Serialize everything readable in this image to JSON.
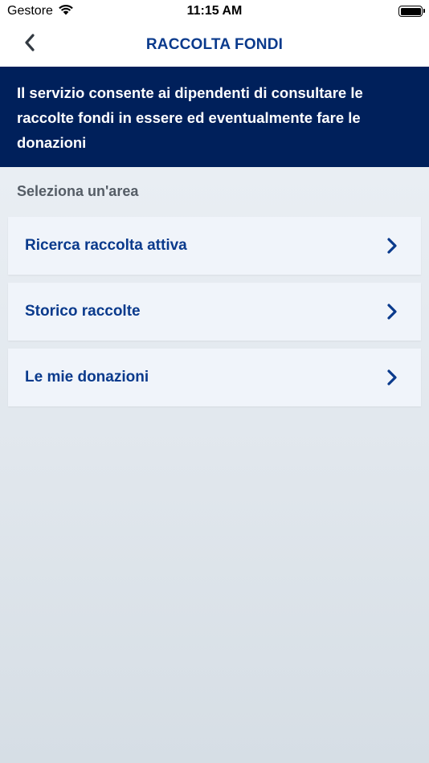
{
  "status_bar": {
    "carrier": "Gestore",
    "time": "11:15 AM",
    "wifi_icon": "wifi-icon",
    "battery_icon": "battery-icon"
  },
  "nav": {
    "title": "RACCOLTA FONDI",
    "back_icon": "chevron-left-icon"
  },
  "banner": {
    "text": "Il servizio consente ai dipendenti di consultare le raccolte fondi in essere ed eventualmente fare le donazioni"
  },
  "section": {
    "label": "Seleziona un'area"
  },
  "menu": {
    "items": [
      {
        "label": "Ricerca raccolta attiva",
        "icon": "chevron-right-icon"
      },
      {
        "label": "Storico raccolte",
        "icon": "chevron-right-icon"
      },
      {
        "label": "Le mie donazioni",
        "icon": "chevron-right-icon"
      }
    ]
  },
  "colors": {
    "brand_dark": "#00205b",
    "brand_blue": "#0a3a8c",
    "card_bg": "#f0f4fa"
  }
}
